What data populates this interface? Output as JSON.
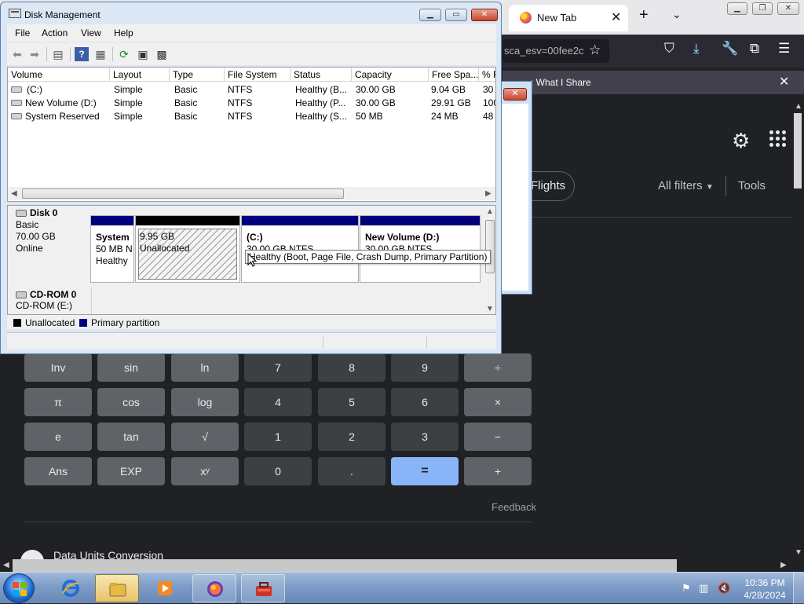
{
  "browser": {
    "tab_title": "New Tab",
    "url_text": "sca_esv=00fee2c",
    "notification_text": ": What I Share",
    "google": {
      "flights_label": "Flights",
      "all_filters_label": "All filters",
      "tools_label": "Tools",
      "feedback_label": "Feedback",
      "data_units_label": "Data Units Conversion"
    },
    "calculator": {
      "rows": [
        [
          "Inv",
          "sin",
          "ln",
          "7",
          "8",
          "9",
          "÷"
        ],
        [
          "π",
          "cos",
          "log",
          "4",
          "5",
          "6",
          "×"
        ],
        [
          "e",
          "tan",
          "√",
          "1",
          "2",
          "3",
          "−"
        ],
        [
          "Ans",
          "EXP",
          "xʸ",
          "0",
          ".",
          "=",
          "+"
        ]
      ]
    }
  },
  "disk_mgmt": {
    "title": "Disk Management",
    "menu": [
      "File",
      "Action",
      "View",
      "Help"
    ],
    "columns": [
      "Volume",
      "Layout",
      "Type",
      "File System",
      "Status",
      "Capacity",
      "Free Spa...",
      "% F"
    ],
    "volumes": [
      {
        "volume": "(C:)",
        "layout": "Simple",
        "type": "Basic",
        "fs": "NTFS",
        "status": "Healthy (B...",
        "capacity": "30.00 GB",
        "free": "9.04 GB",
        "pct": "30"
      },
      {
        "volume": "New Volume (D:)",
        "layout": "Simple",
        "type": "Basic",
        "fs": "NTFS",
        "status": "Healthy (P...",
        "capacity": "30.00 GB",
        "free": "29.91 GB",
        "pct": "100"
      },
      {
        "volume": "System Reserved",
        "layout": "Simple",
        "type": "Basic",
        "fs": "NTFS",
        "status": "Healthy (S...",
        "capacity": "50 MB",
        "free": "24 MB",
        "pct": "48"
      }
    ],
    "disk0": {
      "name": "Disk 0",
      "type": "Basic",
      "size": "70.00 GB",
      "state": "Online",
      "partitions": [
        {
          "title": "System",
          "line1": "50 MB N",
          "line2": "Healthy"
        },
        {
          "title": "",
          "line1": "9.95 GB",
          "line2": "Unallocated"
        },
        {
          "title": "(C:)",
          "line1": "30.00 GB NTFS",
          "line2": "Healthy (Boot, Page File, Crash Dump, Primary Partition)"
        },
        {
          "title": "New Volume  (D:)",
          "line1": "30.00 GB NTFS",
          "line2": ""
        }
      ]
    },
    "cdrom": {
      "name": "CD-ROM 0",
      "drive": "CD-ROM (E:)"
    },
    "legend": {
      "unallocated": "Unallocated",
      "primary": "Primary partition"
    },
    "tooltip": "Healthy (Boot, Page File, Crash Dump, Primary Partition)",
    "colors": {
      "primary": "#00007f",
      "unallocated": "#000000"
    }
  },
  "taskbar": {
    "time": "10:36 PM",
    "date": "4/28/2024"
  }
}
